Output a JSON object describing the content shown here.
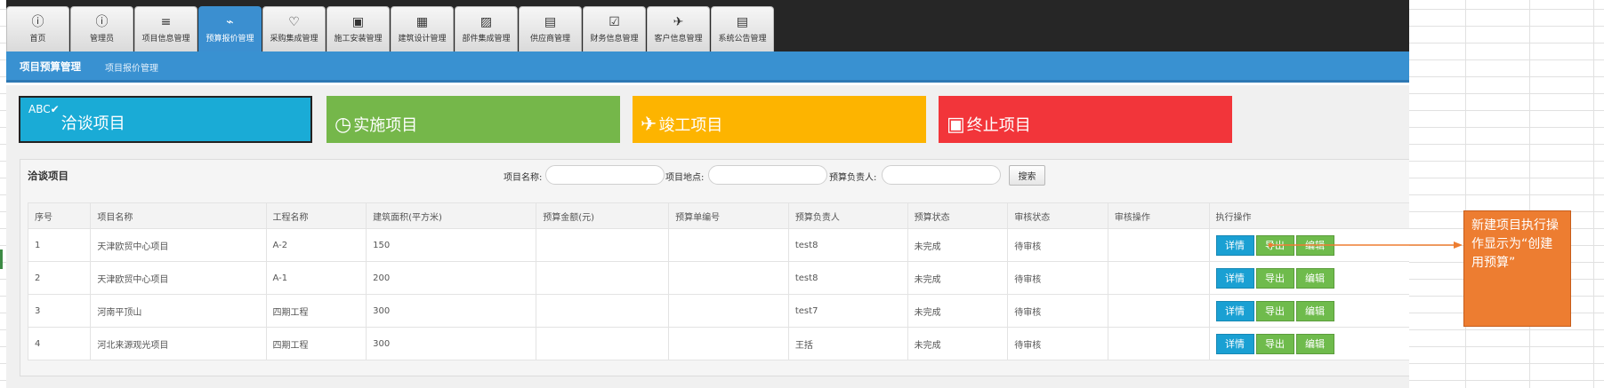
{
  "tabs": [
    {
      "label": "首页",
      "icon": "ⓘ"
    },
    {
      "label": "管理员",
      "icon": "ⓘ"
    },
    {
      "label": "项目信息管理",
      "icon": "≡"
    },
    {
      "label": "预算报价管理",
      "icon": "⌁"
    },
    {
      "label": "采购集成管理",
      "icon": "♡"
    },
    {
      "label": "施工安装管理",
      "icon": "▣"
    },
    {
      "label": "建筑设计管理",
      "icon": "▦"
    },
    {
      "label": "部件集成管理",
      "icon": "▨"
    },
    {
      "label": "供应商管理",
      "icon": "▤"
    },
    {
      "label": "财务信息管理",
      "icon": "☑"
    },
    {
      "label": "客户信息管理",
      "icon": "✈"
    },
    {
      "label": "系统公告管理",
      "icon": "▤"
    }
  ],
  "breadcrumb": {
    "title": "项目预算管理",
    "sub": "项目报价管理"
  },
  "cards": [
    {
      "label": "洽谈项目",
      "icon": "ABC✔",
      "color": "#1aabd6"
    },
    {
      "label": "实施项目",
      "icon": "◷",
      "color": "#75b74a"
    },
    {
      "label": "竣工项目",
      "icon": "✈",
      "color": "#fdb400"
    },
    {
      "label": "终止项目",
      "icon": "▣",
      "color": "#f2353a"
    }
  ],
  "panel": {
    "title": "洽谈项目",
    "search": {
      "name_label": "项目名称:",
      "place_label": "项目地点:",
      "owner_label": "预算负责人:",
      "button": "搜索"
    }
  },
  "table": {
    "headers": [
      "序号",
      "项目名称",
      "工程名称",
      "建筑面积(平方米)",
      "预算金额(元)",
      "预算单编号",
      "预算负责人",
      "预算状态",
      "审核状态",
      "审核操作",
      "执行操作"
    ],
    "rows": [
      {
        "no": "1",
        "name": "天津欧贸中心项目",
        "project": "A-2",
        "area": "150",
        "amount": "",
        "code": "",
        "owner": "test8",
        "status": "未完成",
        "audit": "待审核",
        "audit_op": ""
      },
      {
        "no": "2",
        "name": "天津欧贸中心项目",
        "project": "A-1",
        "area": "200",
        "amount": "",
        "code": "",
        "owner": "test8",
        "status": "未完成",
        "audit": "待审核",
        "audit_op": ""
      },
      {
        "no": "3",
        "name": "河南平顶山",
        "project": "四期工程",
        "area": "300",
        "amount": "",
        "code": "",
        "owner": "test7",
        "status": "未完成",
        "audit": "待审核",
        "audit_op": ""
      },
      {
        "no": "4",
        "name": "河北来源观光项目",
        "project": "四期工程",
        "area": "300",
        "amount": "",
        "code": "",
        "owner": "王括",
        "status": "未完成",
        "audit": "待审核",
        "audit_op": ""
      }
    ],
    "actions": {
      "detail": "详情",
      "export": "导出",
      "edit": "编辑"
    }
  },
  "annotation": {
    "text": "新建项目执行操作显示为“创建用预算”",
    "color": "#ed7d31"
  }
}
